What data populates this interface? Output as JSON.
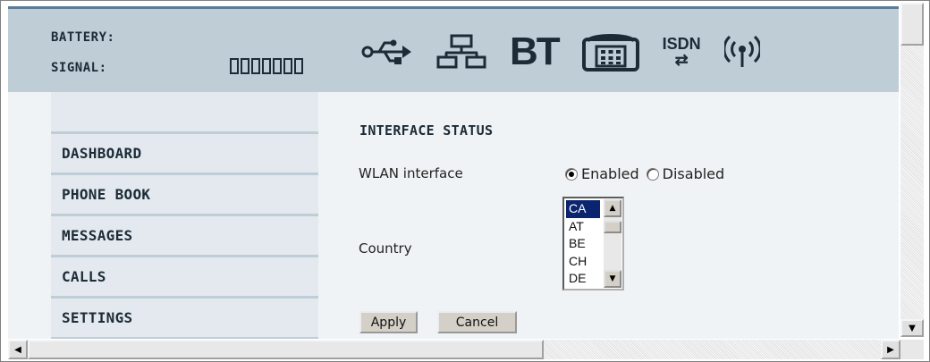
{
  "header": {
    "battery_label": "BATTERY:",
    "signal_label": "SIGNAL:",
    "signal_bars_lit": 0,
    "signal_bars_total": 7,
    "bt_text": "BT",
    "isdn_text": "ISDN",
    "isdn_arrows": "⇄",
    "icons": [
      "usb-icon",
      "lan-icon",
      "bluetooth-icon",
      "phone-icon",
      "isdn-icon",
      "wlan-icon"
    ]
  },
  "sidebar": {
    "items": [
      {
        "label": "DASHBOARD"
      },
      {
        "label": "PHONE BOOK"
      },
      {
        "label": "MESSAGES"
      },
      {
        "label": "CALLS"
      },
      {
        "label": "SETTINGS"
      }
    ]
  },
  "main": {
    "section_title": "INTERFACE STATUS",
    "wlan_label": "WLAN interface",
    "wlan_options": [
      {
        "label": "Enabled",
        "selected": true
      },
      {
        "label": "Disabled",
        "selected": false
      }
    ],
    "country_label": "Country",
    "country_options": [
      "CA",
      "AT",
      "BE",
      "CH",
      "DE"
    ],
    "country_selected": "CA",
    "apply_label": "Apply",
    "cancel_label": "Cancel"
  },
  "colors": {
    "header_bg": "#bfcdd6",
    "header_border": "#5e7d94",
    "sidebar_bg": "#e3e9ee",
    "page_bg": "#f0f3f5",
    "text": "#1c2b36",
    "selection": "#0a2470"
  }
}
